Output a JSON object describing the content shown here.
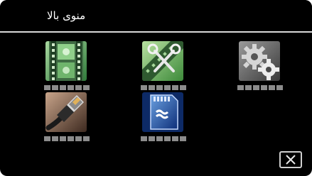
{
  "header": {
    "title": "منوی بالا"
  },
  "menu": {
    "items": [
      {
        "icon": "film-strip-icon"
      },
      {
        "icon": "video-edit-icon"
      },
      {
        "icon": "gear-settings-icon"
      },
      {
        "icon": "hdmi-cable-icon"
      },
      {
        "icon": "sd-card-icon"
      }
    ]
  },
  "footer": {
    "close_icon": "close-x-icon"
  },
  "colors": {
    "background": "#000000",
    "title_text": "#ffffff",
    "divider": "#d9d9d9",
    "placeholder_dots": "#8c8c8c"
  }
}
